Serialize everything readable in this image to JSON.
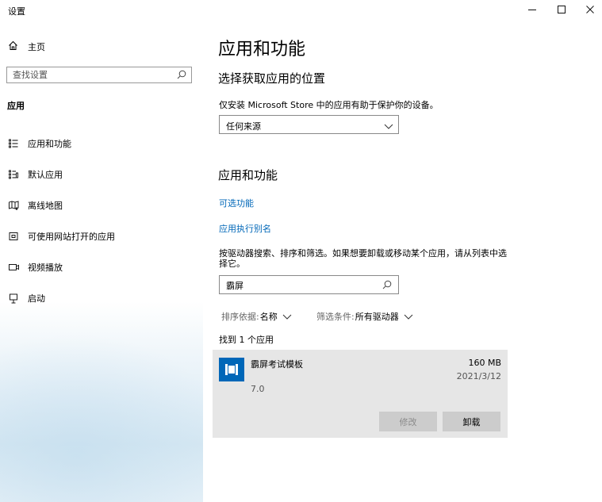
{
  "window": {
    "title": "设置"
  },
  "sidebar": {
    "home_label": "主页",
    "search_placeholder": "查找设置",
    "section_title": "应用",
    "items": [
      {
        "label": "应用和功能",
        "icon": "apps-list-icon"
      },
      {
        "label": "默认应用",
        "icon": "default-apps-icon"
      },
      {
        "label": "离线地图",
        "icon": "offline-maps-icon"
      },
      {
        "label": "可使用网站打开的应用",
        "icon": "apps-for-websites-icon"
      },
      {
        "label": "视频播放",
        "icon": "video-playback-icon"
      },
      {
        "label": "启动",
        "icon": "startup-icon"
      }
    ]
  },
  "main": {
    "title": "应用和功能",
    "install_location_heading": "选择获取应用的位置",
    "install_location_text": "仅安装 Microsoft Store 中的应用有助于保护你的设备。",
    "install_source_selected": "任何来源",
    "apps_heading": "应用和功能",
    "link_optional_features": "可选功能",
    "link_app_aliases": "应用执行别名",
    "search_hint": "按驱动器搜索、排序和筛选。如果想要卸载或移动某个应用，请从列表中选择它。",
    "search_value": "霸屏",
    "sort_label": "排序依据:",
    "sort_value": "名称",
    "filter_label": "筛选条件:",
    "filter_value": "所有驱动器",
    "found_text": "找到 1 个应用",
    "app": {
      "name": "霸屏考试模板",
      "size": "160 MB",
      "date": "2021/3/12",
      "version": "7.0",
      "modify_label": "修改",
      "uninstall_label": "卸载"
    }
  },
  "colors": {
    "accent": "#0067b8",
    "card_bg": "#e6e6e6"
  }
}
